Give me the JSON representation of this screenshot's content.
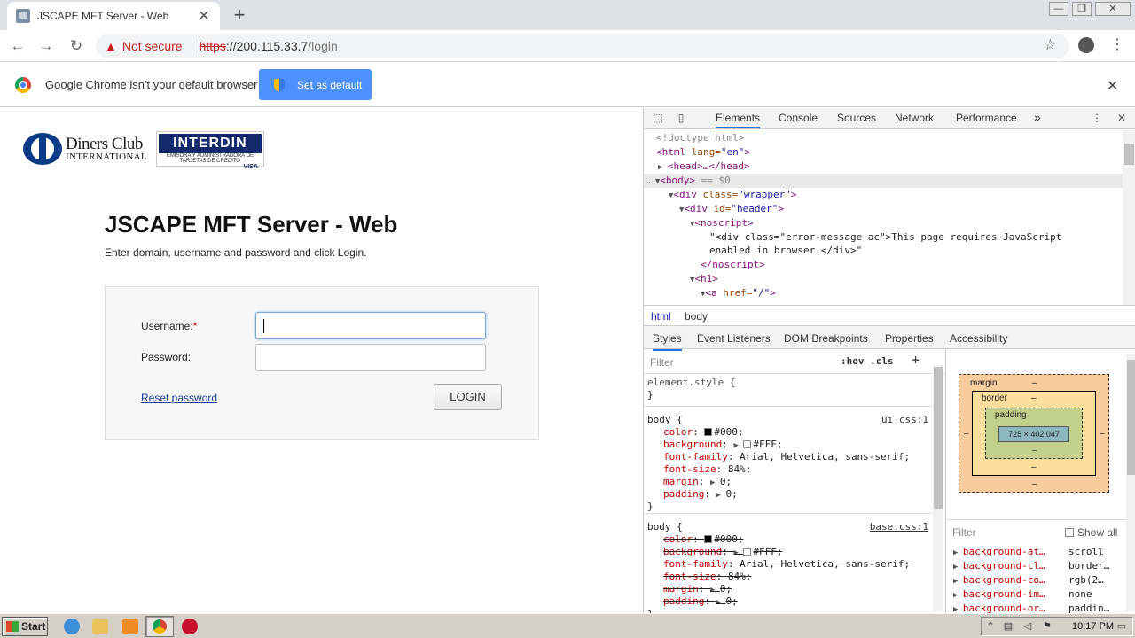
{
  "browser": {
    "tab_title": "JSCAPE MFT Server - Web",
    "tab_close": "✕",
    "new_tab": "+",
    "not_secure": "Not secure",
    "url_scheme": "https",
    "url_host": "://200.115.33.7",
    "url_path": "/login",
    "win_min": "—",
    "win_restore": "❐",
    "win_close": "✕"
  },
  "infobar": {
    "message": "Google Chrome isn't your default browser",
    "button": "Set as default",
    "close": "✕"
  },
  "page": {
    "logo_diners_line1": "Diners Club",
    "logo_diners_line2": "INTERNATIONAL",
    "logo_interdin": "INTERDIN",
    "logo_interdin_sub": "EMISORA Y ADMINISTRADORA DE TARJETAS DE CREDITO",
    "logo_interdin_cards": "VISA",
    "title": "JSCAPE MFT Server - Web",
    "instructions": "Enter domain, username and password and click Login.",
    "username_label": "Username:",
    "required_mark": "*",
    "password_label": "Password:",
    "reset_link": "Reset password",
    "login_button": "LOGIN"
  },
  "devtools": {
    "tabs": [
      "Elements",
      "Console",
      "Sources",
      "Network",
      "Performance"
    ],
    "more_tabs": "»",
    "dom": {
      "doctype": "<!doctype html>",
      "html_open_tag": "<html",
      "html_lang_attr": " lang=",
      "html_lang_val": "\"en\"",
      "html_close": ">",
      "head": "<head>…</head>",
      "body_open": "<body>",
      "body_marker": " == $0",
      "div_wrapper_tag": "<div",
      "div_wrapper_attr": " class=",
      "div_wrapper_val": "\"wrapper\"",
      "div_header_attr": " id=",
      "div_header_val": "\"header\"",
      "noscript_open": "<noscript>",
      "noscript_text1": "\"<div class=\"error-message ac\">This page requires JavaScript",
      "noscript_text2": "enabled in browser.</div>\"",
      "noscript_close": "</noscript>",
      "h1_open": "<h1>",
      "a_tag": "<a",
      "a_attr": " href=",
      "a_val": "\"/\"",
      "gt": ">"
    },
    "crumbs": [
      "html",
      "body"
    ],
    "subtabs": [
      "Styles",
      "Event Listeners",
      "DOM Breakpoints",
      "Properties",
      "Accessibility"
    ],
    "filter_placeholder": "Filter",
    "hov_cls": ":hov  .cls",
    "plus": "+",
    "element_style": "element.style {",
    "close_brace": "}",
    "rule1_selector": "body {",
    "rule1_source": "ui.css:1",
    "rule1_props": [
      {
        "name": "color",
        "value": "#000;",
        "swatch": "#000000"
      },
      {
        "name": "background",
        "value": "#FFF;",
        "swatch": "#ffffff"
      },
      {
        "name": "font-family",
        "value": "Arial, Helvetica, sans-serif;"
      },
      {
        "name": "font-size",
        "value": "84%;"
      },
      {
        "name": "margin",
        "value": "0;"
      },
      {
        "name": "padding",
        "value": "0;"
      }
    ],
    "rule2_selector": "body {",
    "rule2_source": "base.css:1",
    "rule2_props": [
      {
        "name": "color",
        "value": "#000;",
        "swatch": "#000000"
      },
      {
        "name": "background",
        "value": "#FFF;",
        "swatch": "#ffffff"
      },
      {
        "name": "font-family",
        "value": "Arial, Helvetica, sans-serif;"
      },
      {
        "name": "font-size",
        "value": "84%;"
      },
      {
        "name": "margin",
        "value": "0;"
      },
      {
        "name": "padding",
        "value": "0;"
      }
    ],
    "boxmodel": {
      "margin_label": "margin",
      "border_label": "border",
      "padding_label": "padding",
      "dash": "–",
      "content_size": "725 × 402.047"
    },
    "computed_filter": "Filter",
    "show_all": "Show all",
    "computed": [
      {
        "name": "background-at…",
        "value": "scroll"
      },
      {
        "name": "background-cl…",
        "value": "border…"
      },
      {
        "name": "background-co…",
        "value": "rgb(2…"
      },
      {
        "name": "background-im…",
        "value": "none"
      },
      {
        "name": "background-or…",
        "value": "paddin…"
      }
    ]
  },
  "taskbar": {
    "start": "Start",
    "time": "10:17 PM"
  }
}
